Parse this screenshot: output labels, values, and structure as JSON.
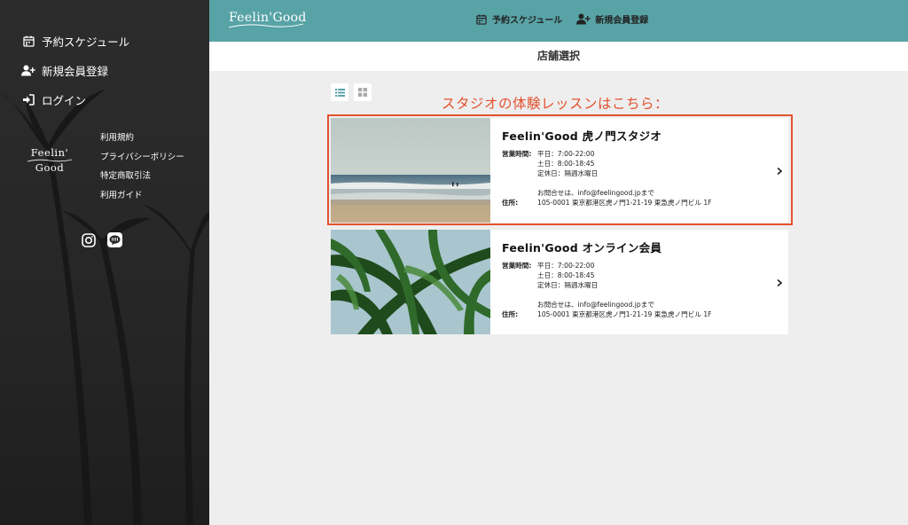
{
  "sidebar": {
    "nav": [
      {
        "label": "予約スケジュール",
        "icon": "calendar-icon"
      },
      {
        "label": "新規会員登録",
        "icon": "user-plus-icon"
      },
      {
        "label": "ログイン",
        "icon": "login-icon"
      }
    ],
    "logo": {
      "line1": "Feelin'",
      "line2": "Good"
    },
    "links": [
      "利用規約",
      "プライバシーポリシー",
      "特定商取引法",
      "利用ガイド"
    ],
    "social": [
      {
        "icon": "instagram-icon"
      },
      {
        "icon": "line-icon"
      }
    ]
  },
  "header": {
    "brand": "Feelin'Good",
    "nav": [
      {
        "label": "予約スケジュール",
        "icon": "calendar-icon"
      },
      {
        "label": "新規会員登録",
        "icon": "user-plus-icon"
      }
    ]
  },
  "page": {
    "title": "店舗選択",
    "annotation": "スタジオの体験レッスンはこちら："
  },
  "view_toggles": [
    {
      "icon": "list-view-icon",
      "active": true
    },
    {
      "icon": "grid-view-icon",
      "active": false
    }
  ],
  "studios": [
    {
      "name": "Feelin'Good 虎ノ門スタジオ",
      "hours_label": "営業時間:",
      "hours": [
        "平日：7:00-22:00",
        "土日：8:00-18:45",
        "定休日：隔週水曜日"
      ],
      "contact": "お問合せは、info@feelingood.jpまで",
      "address_label": "住所:",
      "address": "105-0001 東京都港区虎ノ門1-21-19 東急虎ノ門ビル 1F",
      "image": "beach-photo",
      "highlighted": true
    },
    {
      "name": "Feelin'Good オンライン会員",
      "hours_label": "営業時間:",
      "hours": [
        "平日：7:00-22:00",
        "土日：8:00-18:45",
        "定休日：隔週水曜日"
      ],
      "contact": "お問合せは、info@feelingood.jpまで",
      "address_label": "住所:",
      "address": "105-0001 東京都港区虎ノ門1-21-19 東急虎ノ門ビル 1F",
      "image": "palm-leaves-photo",
      "highlighted": false
    }
  ],
  "colors": {
    "header": "#58a3a6",
    "accent": "#e4522f",
    "sidebar": "#262626"
  }
}
